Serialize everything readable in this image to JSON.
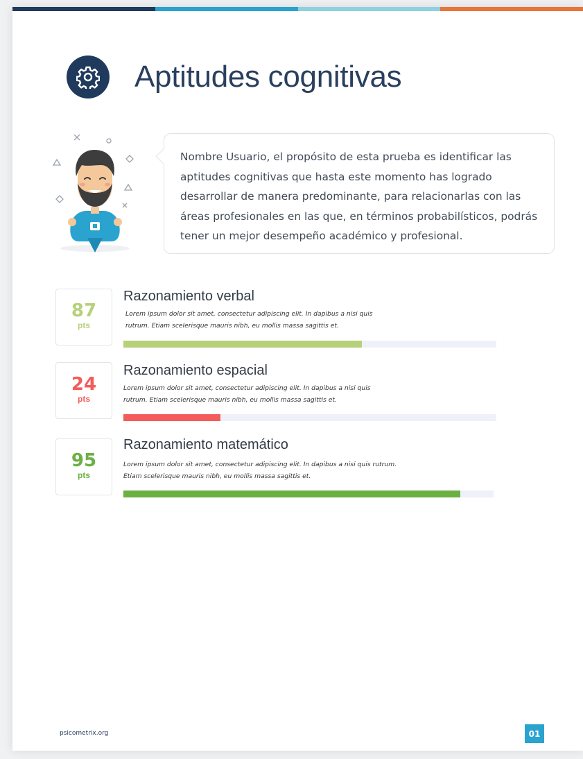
{
  "colors": {
    "bar": [
      "#1f3a5c",
      "#2aa3cf",
      "#8fd0df",
      "#e8743a"
    ],
    "title": "#2a3f5f",
    "icon_bg": "#1f3a5c",
    "track": "#eef1f7"
  },
  "header": {
    "icon": "gear-icon",
    "title": "Aptitudes cognitivas"
  },
  "intro": {
    "avatar": "bearded-man-avatar",
    "text": "Nombre Usuario, el propósito de esta prueba es identificar las aptitudes cognitivas que hasta este momento has logrado desarrollar de manera predominante, para relacionarlas con las áreas profesionales en las que, en términos probabilísticos, podrás tener un mejor desempeño académico y profesional."
  },
  "aptitudes": [
    {
      "score": "87",
      "unit": "pts",
      "color": "#b6d17a",
      "title": "Razonamiento verbal",
      "description": "Lorem ipsum dolor sit amet, consectetur adipiscing elit. In dapibus a nisi quis rutrum. Etiam scelerisque mauris nibh, eu mollis massa sagittis et.",
      "percent": 64
    },
    {
      "score": "24",
      "unit": "pts",
      "color": "#f45b5b",
      "title": "Razonamiento espacial",
      "description": "Lorem ipsum dolor sit amet, consectetur adipiscing elit. In dapibus a nisi quis rutrum. Etiam scelerisque mauris nibh, eu mollis massa sagittis et.",
      "percent": 26
    },
    {
      "score": "95",
      "unit": "pts",
      "color": "#6ab043",
      "title": "Razonamiento matemático",
      "description": "Lorem ipsum dolor sit amet, consectetur adipiscing elit. In dapibus a nisi quis rutrum. Etiam scelerisque mauris nibh, eu mollis massa sagittis et.",
      "percent": 91
    }
  ],
  "footer": {
    "url": "psicometrix.org",
    "page": "01"
  }
}
